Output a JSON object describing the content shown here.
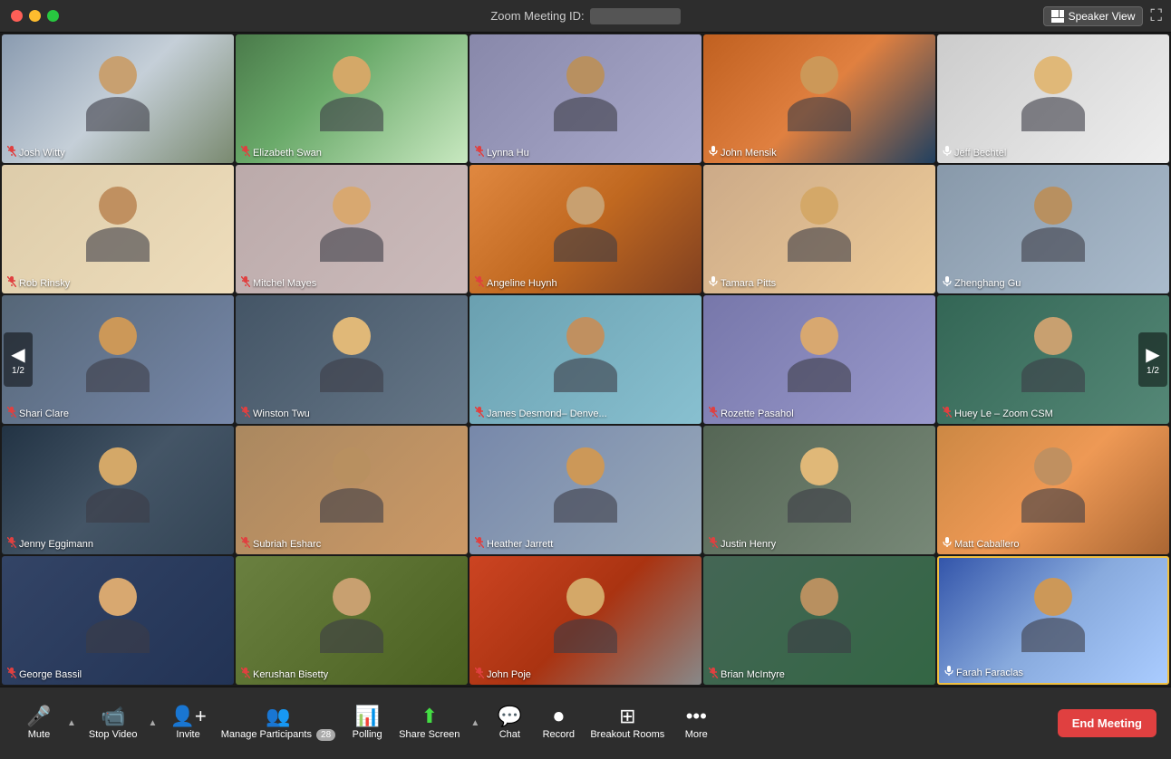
{
  "titlebar": {
    "meeting_id_label": "Zoom Meeting ID:",
    "speaker_view_label": "Speaker View"
  },
  "grid": {
    "page_current": "1",
    "page_total": "2",
    "participants": [
      {
        "id": 1,
        "name": "Josh Witty",
        "muted": true,
        "highlighted": false,
        "tile_class": "tile-1"
      },
      {
        "id": 2,
        "name": "Elizabeth Swan",
        "muted": true,
        "highlighted": false,
        "tile_class": "tile-2"
      },
      {
        "id": 3,
        "name": "Lynna Hu",
        "muted": true,
        "highlighted": false,
        "tile_class": "tile-3"
      },
      {
        "id": 4,
        "name": "John Mensik",
        "muted": false,
        "highlighted": false,
        "tile_class": "tile-4"
      },
      {
        "id": 5,
        "name": "Jeff Bechtel",
        "muted": false,
        "highlighted": false,
        "tile_class": "tile-5"
      },
      {
        "id": 6,
        "name": "Rob Rinsky",
        "muted": true,
        "highlighted": false,
        "tile_class": "tile-6"
      },
      {
        "id": 7,
        "name": "Mitchel Mayes",
        "muted": true,
        "highlighted": false,
        "tile_class": "tile-7"
      },
      {
        "id": 8,
        "name": "Angeline Huynh",
        "muted": true,
        "highlighted": false,
        "tile_class": "tile-8"
      },
      {
        "id": 9,
        "name": "Tamara Pitts",
        "muted": false,
        "highlighted": false,
        "tile_class": "tile-9"
      },
      {
        "id": 10,
        "name": "Zhenghang Gu",
        "muted": false,
        "highlighted": false,
        "tile_class": "tile-10"
      },
      {
        "id": 11,
        "name": "Shari Clare",
        "muted": true,
        "highlighted": false,
        "tile_class": "tile-11"
      },
      {
        "id": 12,
        "name": "Winston Twu",
        "muted": true,
        "highlighted": false,
        "tile_class": "tile-12"
      },
      {
        "id": 13,
        "name": "James Desmond– Denve...",
        "muted": true,
        "highlighted": false,
        "tile_class": "tile-13"
      },
      {
        "id": 14,
        "name": "Rozette Pasahol",
        "muted": true,
        "highlighted": false,
        "tile_class": "tile-14"
      },
      {
        "id": 15,
        "name": "Huey Le – Zoom CSM",
        "muted": true,
        "highlighted": false,
        "tile_class": "tile-15"
      },
      {
        "id": 16,
        "name": "Jenny Eggimann",
        "muted": true,
        "highlighted": false,
        "tile_class": "tile-16"
      },
      {
        "id": 17,
        "name": "Subriah Esharc",
        "muted": true,
        "highlighted": false,
        "tile_class": "tile-17"
      },
      {
        "id": 18,
        "name": "Heather Jarrett",
        "muted": true,
        "highlighted": false,
        "tile_class": "tile-18"
      },
      {
        "id": 19,
        "name": "Justin Henry",
        "muted": true,
        "highlighted": false,
        "tile_class": "tile-19"
      },
      {
        "id": 20,
        "name": "Matt Caballero",
        "muted": false,
        "highlighted": false,
        "tile_class": "tile-20"
      },
      {
        "id": 21,
        "name": "George Bassil",
        "muted": true,
        "highlighted": false,
        "tile_class": "tile-21"
      },
      {
        "id": 22,
        "name": "Kerushan Bisetty",
        "muted": true,
        "highlighted": false,
        "tile_class": "tile-22"
      },
      {
        "id": 23,
        "name": "John Poje",
        "muted": true,
        "highlighted": false,
        "tile_class": "tile-23"
      },
      {
        "id": 24,
        "name": "Brian McIntyre",
        "muted": true,
        "highlighted": false,
        "tile_class": "tile-24"
      },
      {
        "id": 25,
        "name": "Farah Faraclas",
        "muted": false,
        "highlighted": true,
        "tile_class": "tile-25"
      }
    ]
  },
  "toolbar": {
    "mute_label": "Mute",
    "stop_video_label": "Stop Video",
    "invite_label": "Invite",
    "manage_participants_label": "Manage Participants",
    "participants_count": "28",
    "polling_label": "Polling",
    "share_screen_label": "Share Screen",
    "chat_label": "Chat",
    "record_label": "Record",
    "breakout_rooms_label": "Breakout Rooms",
    "more_label": "More",
    "end_meeting_label": "End Meeting"
  }
}
